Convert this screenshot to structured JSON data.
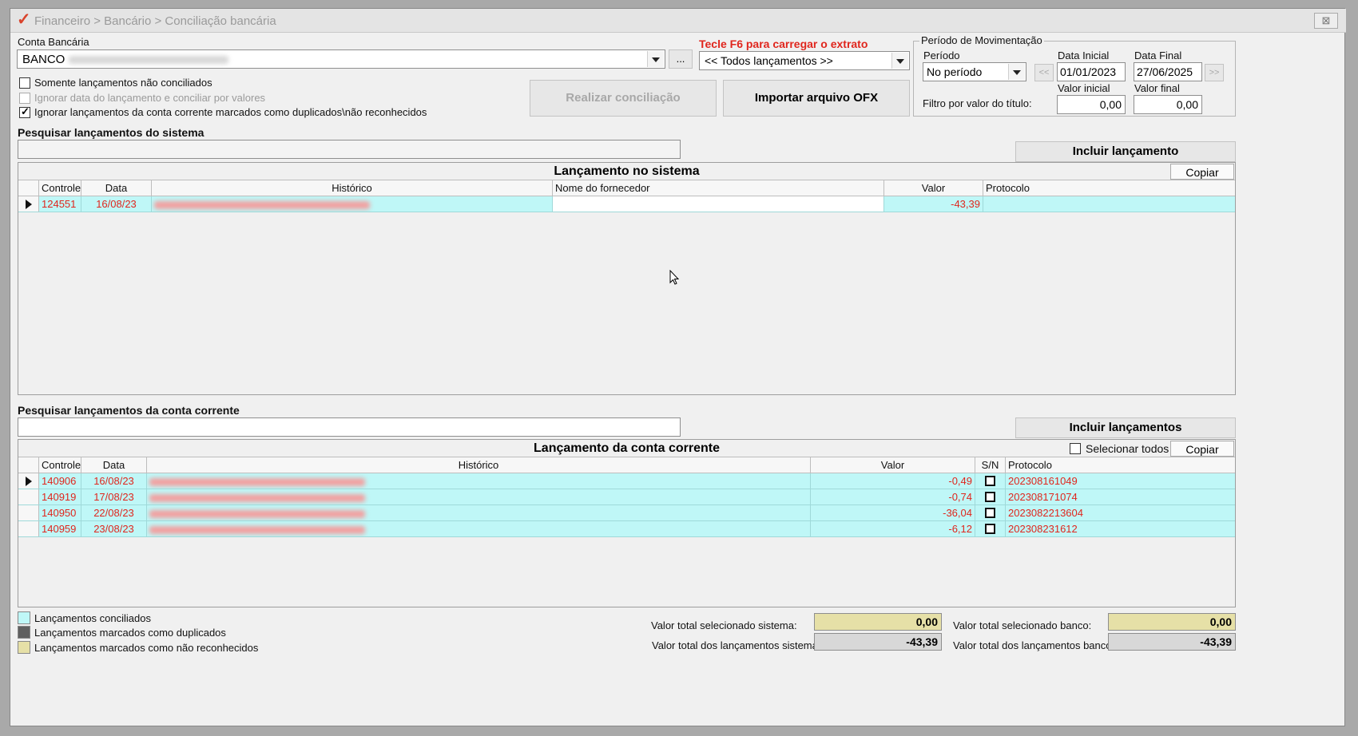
{
  "window": {
    "breadcrumb": "Financeiro > Bancário > Conciliação bancária",
    "close": "⊠"
  },
  "conta": {
    "label": "Conta Bancária",
    "value": "BANCO",
    "browse_label": "..."
  },
  "extrato": {
    "hint": "Tecle F6 para carregar o extrato",
    "selected": "<< Todos lançamentos >>"
  },
  "options": {
    "somente_nao_conciliados": "Somente lançamentos não conciliados",
    "ignorar_data": "Ignorar data do lançamento e conciliar por valores",
    "ignorar_duplicados": "Ignorar lançamentos da conta corrente marcados como duplicados\\não reconhecidos"
  },
  "actions": {
    "realizar": "Realizar conciliação",
    "importar": "Importar arquivo OFX"
  },
  "periodo": {
    "group_title": "Período de Movimentação",
    "periodo_label": "Período",
    "periodo_value": "No período",
    "data_inicial_label": "Data Inicial",
    "data_inicial": "01/01/2023",
    "data_final_label": "Data Final",
    "data_final": "27/06/2025",
    "prev": "<<",
    "next": ">>",
    "filtro_label": "Filtro por valor do título:",
    "valor_inicial_label": "Valor inicial",
    "valor_inicial": "0,00",
    "valor_final_label": "Valor final",
    "valor_final": "0,00"
  },
  "sistema": {
    "search_label": "Pesquisar lançamentos do sistema",
    "search_value": "",
    "incluir": "Incluir lançamento",
    "grid_title": "Lançamento no sistema",
    "copiar": "Copiar",
    "columns": [
      "Controle",
      "Data",
      "Histórico",
      "Nome do fornecedor",
      "Valor",
      "Protocolo"
    ],
    "rows": [
      {
        "controle": "124551",
        "data": "16/08/23",
        "historico": "",
        "fornecedor": "",
        "valor": "-43,39",
        "protocolo": ""
      }
    ]
  },
  "conta_corrente": {
    "search_label": "Pesquisar lançamentos da conta corrente",
    "search_value": "",
    "incluir": "Incluir lançamentos",
    "grid_title": "Lançamento da conta corrente",
    "selecionar_todos": "Selecionar todos",
    "copiar": "Copiar",
    "columns": [
      "Controle",
      "Data",
      "Histórico",
      "Valor",
      "S/N",
      "Protocolo"
    ],
    "rows": [
      {
        "controle": "140906",
        "data": "16/08/23",
        "historico": "",
        "valor": "-0,49",
        "protocolo": "202308161049"
      },
      {
        "controle": "140919",
        "data": "17/08/23",
        "historico": "",
        "valor": "-0,74",
        "protocolo": "202308171074"
      },
      {
        "controle": "140950",
        "data": "22/08/23",
        "historico": "",
        "valor": "-36,04",
        "protocolo": "2023082213604"
      },
      {
        "controle": "140959",
        "data": "23/08/23",
        "historico": "",
        "valor": "-6,12",
        "protocolo": "202308231612"
      }
    ]
  },
  "legend": [
    {
      "label": "Lançamentos conciliados",
      "color": "#bff7f7"
    },
    {
      "label": "Lançamentos marcados como duplicados",
      "color": "#5f5f5f"
    },
    {
      "label": "Lançamentos marcados como não reconhecidos",
      "color": "#e6e0a7"
    }
  ],
  "totals": {
    "sel_sistema_label": "Valor total selecionado sistema:",
    "sel_sistema": "0,00",
    "tot_sistema_label": "Valor total dos lançamentos sistema:",
    "tot_sistema": "-43,39",
    "sel_banco_label": "Valor total selecionado banco:",
    "sel_banco": "0,00",
    "tot_banco_label": "Valor total dos lançamentos banco:",
    "tot_banco": "-43,39"
  }
}
